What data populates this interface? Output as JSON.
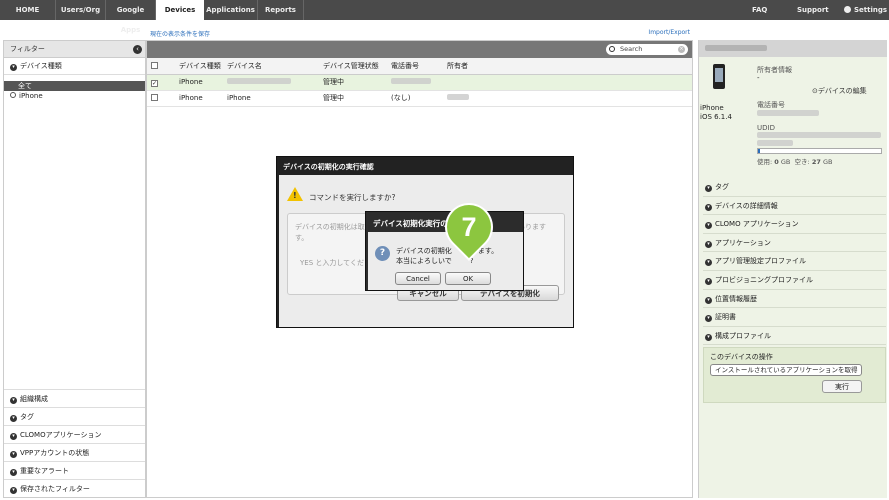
{
  "nav": {
    "tabs": [
      "HOME",
      "Users/Org",
      "Google Apps",
      "Devices",
      "Applications",
      "Reports"
    ],
    "right": [
      "FAQ",
      "Support",
      "Settings"
    ]
  },
  "filter": {
    "title": "フィルター",
    "device_type": "デバイス種類",
    "all": "全て",
    "iphone": "iPhone",
    "bottom": [
      "組織構成",
      "タグ",
      "CLOMOアプリケーション",
      "VPPアカウントの状態",
      "重要なアラート",
      "保存されたフィルター"
    ]
  },
  "links": {
    "save": "現在の表示条件を保存",
    "import": "Import/Export"
  },
  "search": {
    "placeholder": "Search"
  },
  "table": {
    "headers": [
      "デバイス種類",
      "デバイス名",
      "デバイス管理状態",
      "電話番号",
      "所有者"
    ],
    "rows": [
      {
        "type": "iPhone",
        "name": "",
        "status": "管理中",
        "phone": "",
        "owner": "",
        "checked": true
      },
      {
        "type": "iPhone",
        "name": "iPhone",
        "status": "管理中",
        "phone": "(なし)",
        "owner": "",
        "checked": false
      }
    ]
  },
  "device": {
    "model": "iPhone",
    "os": "iOS 6.1.4",
    "owner_label": "所有者情報",
    "owner_value": "-",
    "edit_link": "デバイスの編集",
    "phone_label": "電話番号",
    "udid_label": "UDID",
    "used_label": "使用:",
    "used_value": "0",
    "used_unit": "GB",
    "free_label": "空き:",
    "free_value": "27",
    "free_unit": "GB",
    "storage_used_fraction": 0.02
  },
  "accordion": [
    "タグ",
    "デバイスの詳細情報",
    "CLOMO アプリケーション",
    "アプリケーション",
    "アプリ管理設定プロファイル",
    "プロビジョニングプロファイル",
    "位置情報履歴",
    "証明書",
    "構成プロファイル"
  ],
  "ops": {
    "title": "このデバイスの操作",
    "select": "インストールされているアプリケーションを取得",
    "run": "実行"
  },
  "dialog": {
    "title": "デバイスの初期化の実行確認",
    "question": "コマンドを実行しますか?",
    "line1": "デバイスの初期化は取",
    "line1_end": "あります",
    "line2": "す。",
    "yes_hint": "YES と入力してくださ",
    "cancel": "キャンセル",
    "confirm": "デバイスを初期化"
  },
  "modal": {
    "title": "デバイス初期化実行の",
    "text1": "デバイスの初期化",
    "text1_end": "ます。",
    "text2": "本当によろしいで",
    "text2_end": "?",
    "cancel": "Cancel",
    "ok": "OK"
  },
  "step": "7",
  "colors": {
    "accent": "#8cc63f",
    "nav": "#4a4a4a",
    "link": "#2a6ebb"
  }
}
